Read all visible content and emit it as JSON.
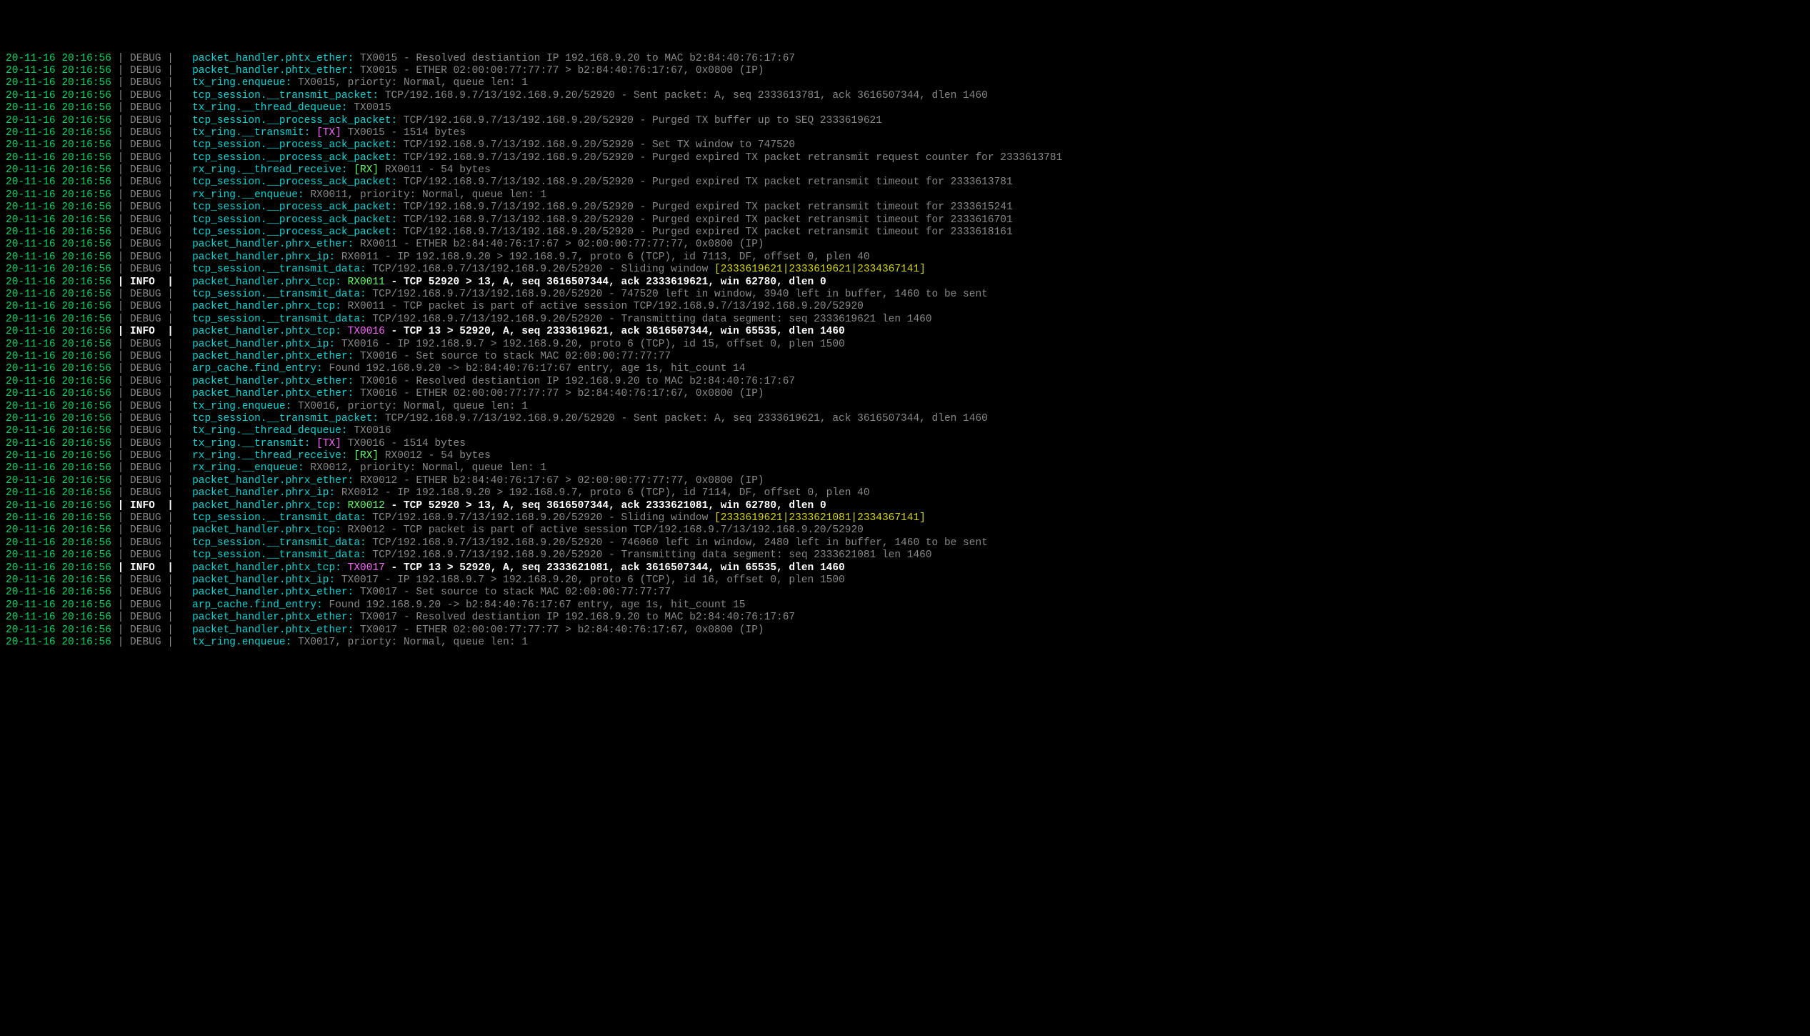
{
  "rows": [
    {
      "ts": "20-11-16 20:16:56",
      "lvl": "DEBUG",
      "mod": "packet_handler.phtx_ether:",
      "segs": [
        {
          "t": " TX0015 - Resolved destiantion IP 192.168.9.20 to MAC b2:84:40:76:17:67",
          "cls": "msg"
        }
      ]
    },
    {
      "ts": "20-11-16 20:16:56",
      "lvl": "DEBUG",
      "mod": "packet_handler.phtx_ether:",
      "segs": [
        {
          "t": " TX0015 - ETHER 02:00:00:77:77:77 > b2:84:40:76:17:67, 0x0800 (IP)",
          "cls": "msg"
        }
      ]
    },
    {
      "ts": "20-11-16 20:16:56",
      "lvl": "DEBUG",
      "mod": "tx_ring.enqueue:",
      "segs": [
        {
          "t": " TX0015, priorty: Normal, queue len: 1",
          "cls": "msg"
        }
      ]
    },
    {
      "ts": "20-11-16 20:16:56",
      "lvl": "DEBUG",
      "mod": "tcp_session.__transmit_packet:",
      "segs": [
        {
          "t": " TCP/192.168.9.7/13/192.168.9.20/52920 - Sent packet: A, seq 2333613781, ack 3616507344, dlen 1460",
          "cls": "msg"
        }
      ]
    },
    {
      "ts": "20-11-16 20:16:56",
      "lvl": "DEBUG",
      "mod": "tx_ring.__thread_dequeue:",
      "segs": [
        {
          "t": " TX0015",
          "cls": "msg"
        }
      ]
    },
    {
      "ts": "20-11-16 20:16:56",
      "lvl": "DEBUG",
      "mod": "tcp_session.__process_ack_packet:",
      "segs": [
        {
          "t": " TCP/192.168.9.7/13/192.168.9.20/52920 - Purged TX buffer up to SEQ 2333619621",
          "cls": "msg"
        }
      ]
    },
    {
      "ts": "20-11-16 20:16:56",
      "lvl": "DEBUG",
      "mod": "tx_ring.__transmit:",
      "segs": [
        {
          "t": " [TX]",
          "cls": "tx"
        },
        {
          "t": " TX0015 - 1514 bytes",
          "cls": "msg"
        }
      ]
    },
    {
      "ts": "20-11-16 20:16:56",
      "lvl": "DEBUG",
      "mod": "tcp_session.__process_ack_packet:",
      "segs": [
        {
          "t": " TCP/192.168.9.7/13/192.168.9.20/52920 - Set TX window to 747520",
          "cls": "msg"
        }
      ]
    },
    {
      "ts": "20-11-16 20:16:56",
      "lvl": "DEBUG",
      "mod": "tcp_session.__process_ack_packet:",
      "segs": [
        {
          "t": " TCP/192.168.9.7/13/192.168.9.20/52920 - Purged expired TX packet retransmit request counter for 2333613781",
          "cls": "msg"
        }
      ]
    },
    {
      "ts": "20-11-16 20:16:56",
      "lvl": "DEBUG",
      "mod": "rx_ring.__thread_receive:",
      "segs": [
        {
          "t": " [RX]",
          "cls": "rx"
        },
        {
          "t": " RX0011 - 54 bytes",
          "cls": "msg"
        }
      ]
    },
    {
      "ts": "20-11-16 20:16:56",
      "lvl": "DEBUG",
      "mod": "tcp_session.__process_ack_packet:",
      "segs": [
        {
          "t": " TCP/192.168.9.7/13/192.168.9.20/52920 - Purged expired TX packet retransmit timeout for 2333613781",
          "cls": "msg"
        }
      ]
    },
    {
      "ts": "20-11-16 20:16:56",
      "lvl": "DEBUG",
      "mod": "rx_ring.__enqueue:",
      "segs": [
        {
          "t": " RX0011, priority: Normal, queue len: 1",
          "cls": "msg"
        }
      ]
    },
    {
      "ts": "20-11-16 20:16:56",
      "lvl": "DEBUG",
      "mod": "tcp_session.__process_ack_packet:",
      "segs": [
        {
          "t": " TCP/192.168.9.7/13/192.168.9.20/52920 - Purged expired TX packet retransmit timeout for 2333615241",
          "cls": "msg"
        }
      ]
    },
    {
      "ts": "20-11-16 20:16:56",
      "lvl": "DEBUG",
      "mod": "tcp_session.__process_ack_packet:",
      "segs": [
        {
          "t": " TCP/192.168.9.7/13/192.168.9.20/52920 - Purged expired TX packet retransmit timeout for 2333616701",
          "cls": "msg"
        }
      ]
    },
    {
      "ts": "20-11-16 20:16:56",
      "lvl": "DEBUG",
      "mod": "tcp_session.__process_ack_packet:",
      "segs": [
        {
          "t": " TCP/192.168.9.7/13/192.168.9.20/52920 - Purged expired TX packet retransmit timeout for 2333618161",
          "cls": "msg"
        }
      ]
    },
    {
      "ts": "20-11-16 20:16:56",
      "lvl": "DEBUG",
      "mod": "packet_handler.phrx_ether:",
      "segs": [
        {
          "t": " RX0011 - ETHER b2:84:40:76:17:67 > 02:00:00:77:77:77, 0x0800 (IP)",
          "cls": "msg"
        }
      ]
    },
    {
      "ts": "20-11-16 20:16:56",
      "lvl": "DEBUG",
      "mod": "packet_handler.phrx_ip:",
      "segs": [
        {
          "t": " RX0011 - IP 192.168.9.20 > 192.168.9.7, proto 6 (TCP), id 7113, DF, offset 0, plen 40",
          "cls": "msg"
        }
      ]
    },
    {
      "ts": "20-11-16 20:16:56",
      "lvl": "DEBUG",
      "mod": "tcp_session.__transmit_data:",
      "segs": [
        {
          "t": " TCP/192.168.9.7/13/192.168.9.20/52920 - Sliding window ",
          "cls": "msg"
        },
        {
          "t": "[2333619621|2333619621|2334367141]",
          "cls": "yel"
        }
      ]
    },
    {
      "ts": "20-11-16 20:16:56",
      "lvl": "INFO",
      "mod": "packet_handler.phrx_tcp:",
      "segs": [
        {
          "t": " RX0011",
          "cls": "rx"
        },
        {
          "t": " - TCP 52920 > 13, A, seq 3616507344, ack 2333619621, win 62780, dlen 0",
          "cls": "msgw"
        }
      ]
    },
    {
      "ts": "20-11-16 20:16:56",
      "lvl": "DEBUG",
      "mod": "tcp_session.__transmit_data:",
      "segs": [
        {
          "t": " TCP/192.168.9.7/13/192.168.9.20/52920 - 747520 left in window, 3940 left in buffer, 1460 to be sent",
          "cls": "msg"
        }
      ]
    },
    {
      "ts": "20-11-16 20:16:56",
      "lvl": "DEBUG",
      "mod": "packet_handler.phrx_tcp:",
      "segs": [
        {
          "t": " RX0011 - TCP packet is part of active session TCP/192.168.9.7/13/192.168.9.20/52920",
          "cls": "msg"
        }
      ]
    },
    {
      "ts": "20-11-16 20:16:56",
      "lvl": "DEBUG",
      "mod": "tcp_session.__transmit_data:",
      "segs": [
        {
          "t": " TCP/192.168.9.7/13/192.168.9.20/52920 - Transmitting data segment: seq 2333619621 len 1460",
          "cls": "msg"
        }
      ]
    },
    {
      "ts": "20-11-16 20:16:56",
      "lvl": "INFO",
      "mod": "packet_handler.phtx_tcp:",
      "segs": [
        {
          "t": " TX0016",
          "cls": "tx"
        },
        {
          "t": " - TCP 13 > 52920, A, seq 2333619621, ack 3616507344, win 65535, dlen 1460",
          "cls": "msgw"
        }
      ]
    },
    {
      "ts": "20-11-16 20:16:56",
      "lvl": "DEBUG",
      "mod": "packet_handler.phtx_ip:",
      "segs": [
        {
          "t": " TX0016 - IP 192.168.9.7 > 192.168.9.20, proto 6 (TCP), id 15, offset 0, plen 1500",
          "cls": "msg"
        }
      ]
    },
    {
      "ts": "20-11-16 20:16:56",
      "lvl": "DEBUG",
      "mod": "packet_handler.phtx_ether:",
      "segs": [
        {
          "t": " TX0016 - Set source to stack MAC 02:00:00:77:77:77",
          "cls": "msg"
        }
      ]
    },
    {
      "ts": "20-11-16 20:16:56",
      "lvl": "DEBUG",
      "mod": "arp_cache.find_entry:",
      "segs": [
        {
          "t": " Found 192.168.9.20 -> b2:84:40:76:17:67 entry, age 1s, hit_count 14",
          "cls": "msg"
        }
      ]
    },
    {
      "ts": "20-11-16 20:16:56",
      "lvl": "DEBUG",
      "mod": "packet_handler.phtx_ether:",
      "segs": [
        {
          "t": " TX0016 - Resolved destiantion IP 192.168.9.20 to MAC b2:84:40:76:17:67",
          "cls": "msg"
        }
      ]
    },
    {
      "ts": "20-11-16 20:16:56",
      "lvl": "DEBUG",
      "mod": "packet_handler.phtx_ether:",
      "segs": [
        {
          "t": " TX0016 - ETHER 02:00:00:77:77:77 > b2:84:40:76:17:67, 0x0800 (IP)",
          "cls": "msg"
        }
      ]
    },
    {
      "ts": "20-11-16 20:16:56",
      "lvl": "DEBUG",
      "mod": "tx_ring.enqueue:",
      "segs": [
        {
          "t": " TX0016, priorty: Normal, queue len: 1",
          "cls": "msg"
        }
      ]
    },
    {
      "ts": "20-11-16 20:16:56",
      "lvl": "DEBUG",
      "mod": "tcp_session.__transmit_packet:",
      "segs": [
        {
          "t": " TCP/192.168.9.7/13/192.168.9.20/52920 - Sent packet: A, seq 2333619621, ack 3616507344, dlen 1460",
          "cls": "msg"
        }
      ]
    },
    {
      "ts": "20-11-16 20:16:56",
      "lvl": "DEBUG",
      "mod": "tx_ring.__thread_dequeue:",
      "segs": [
        {
          "t": " TX0016",
          "cls": "msg"
        }
      ]
    },
    {
      "ts": "20-11-16 20:16:56",
      "lvl": "DEBUG",
      "mod": "tx_ring.__transmit:",
      "segs": [
        {
          "t": " [TX]",
          "cls": "tx"
        },
        {
          "t": " TX0016 - 1514 bytes",
          "cls": "msg"
        }
      ]
    },
    {
      "ts": "20-11-16 20:16:56",
      "lvl": "DEBUG",
      "mod": "rx_ring.__thread_receive:",
      "segs": [
        {
          "t": " [RX]",
          "cls": "rx"
        },
        {
          "t": " RX0012 - 54 bytes",
          "cls": "msg"
        }
      ]
    },
    {
      "ts": "20-11-16 20:16:56",
      "lvl": "DEBUG",
      "mod": "rx_ring.__enqueue:",
      "segs": [
        {
          "t": " RX0012, priority: Normal, queue len: 1",
          "cls": "msg"
        }
      ]
    },
    {
      "ts": "20-11-16 20:16:56",
      "lvl": "DEBUG",
      "mod": "packet_handler.phrx_ether:",
      "segs": [
        {
          "t": " RX0012 - ETHER b2:84:40:76:17:67 > 02:00:00:77:77:77, 0x0800 (IP)",
          "cls": "msg"
        }
      ]
    },
    {
      "ts": "20-11-16 20:16:56",
      "lvl": "DEBUG",
      "mod": "packet_handler.phrx_ip:",
      "segs": [
        {
          "t": " RX0012 - IP 192.168.9.20 > 192.168.9.7, proto 6 (TCP), id 7114, DF, offset 0, plen 40",
          "cls": "msg"
        }
      ]
    },
    {
      "ts": "20-11-16 20:16:56",
      "lvl": "INFO",
      "mod": "packet_handler.phrx_tcp:",
      "segs": [
        {
          "t": " RX0012",
          "cls": "rx"
        },
        {
          "t": " - TCP 52920 > 13, A, seq 3616507344, ack 2333621081, win 62780, dlen 0",
          "cls": "msgw"
        }
      ]
    },
    {
      "ts": "20-11-16 20:16:56",
      "lvl": "DEBUG",
      "mod": "tcp_session.__transmit_data:",
      "segs": [
        {
          "t": " TCP/192.168.9.7/13/192.168.9.20/52920 - Sliding window ",
          "cls": "msg"
        },
        {
          "t": "[2333619621|2333621081|2334367141]",
          "cls": "yel"
        }
      ]
    },
    {
      "ts": "20-11-16 20:16:56",
      "lvl": "DEBUG",
      "mod": "packet_handler.phrx_tcp:",
      "segs": [
        {
          "t": " RX0012 - TCP packet is part of active session TCP/192.168.9.7/13/192.168.9.20/52920",
          "cls": "msg"
        }
      ]
    },
    {
      "ts": "20-11-16 20:16:56",
      "lvl": "DEBUG",
      "mod": "tcp_session.__transmit_data:",
      "segs": [
        {
          "t": " TCP/192.168.9.7/13/192.168.9.20/52920 - 746060 left in window, 2480 left in buffer, 1460 to be sent",
          "cls": "msg"
        }
      ]
    },
    {
      "ts": "20-11-16 20:16:56",
      "lvl": "DEBUG",
      "mod": "tcp_session.__transmit_data:",
      "segs": [
        {
          "t": " TCP/192.168.9.7/13/192.168.9.20/52920 - Transmitting data segment: seq 2333621081 len 1460",
          "cls": "msg"
        }
      ]
    },
    {
      "ts": "20-11-16 20:16:56",
      "lvl": "INFO",
      "mod": "packet_handler.phtx_tcp:",
      "segs": [
        {
          "t": " TX0017",
          "cls": "tx"
        },
        {
          "t": " - TCP 13 > 52920, A, seq 2333621081, ack 3616507344, win 65535, dlen 1460",
          "cls": "msgw"
        }
      ]
    },
    {
      "ts": "20-11-16 20:16:56",
      "lvl": "DEBUG",
      "mod": "packet_handler.phtx_ip:",
      "segs": [
        {
          "t": " TX0017 - IP 192.168.9.7 > 192.168.9.20, proto 6 (TCP), id 16, offset 0, plen 1500",
          "cls": "msg"
        }
      ]
    },
    {
      "ts": "20-11-16 20:16:56",
      "lvl": "DEBUG",
      "mod": "packet_handler.phtx_ether:",
      "segs": [
        {
          "t": " TX0017 - Set source to stack MAC 02:00:00:77:77:77",
          "cls": "msg"
        }
      ]
    },
    {
      "ts": "20-11-16 20:16:56",
      "lvl": "DEBUG",
      "mod": "arp_cache.find_entry:",
      "segs": [
        {
          "t": " Found 192.168.9.20 -> b2:84:40:76:17:67 entry, age 1s, hit_count 15",
          "cls": "msg"
        }
      ]
    },
    {
      "ts": "20-11-16 20:16:56",
      "lvl": "DEBUG",
      "mod": "packet_handler.phtx_ether:",
      "segs": [
        {
          "t": " TX0017 - Resolved destiantion IP 192.168.9.20 to MAC b2:84:40:76:17:67",
          "cls": "msg"
        }
      ]
    },
    {
      "ts": "20-11-16 20:16:56",
      "lvl": "DEBUG",
      "mod": "packet_handler.phtx_ether:",
      "segs": [
        {
          "t": " TX0017 - ETHER 02:00:00:77:77:77 > b2:84:40:76:17:67, 0x0800 (IP)",
          "cls": "msg"
        }
      ]
    },
    {
      "ts": "20-11-16 20:16:56",
      "lvl": "DEBUG",
      "mod": "tx_ring.enqueue:",
      "segs": [
        {
          "t": " TX0017, priorty: Normal, queue len: 1",
          "cls": "msg"
        }
      ]
    }
  ]
}
